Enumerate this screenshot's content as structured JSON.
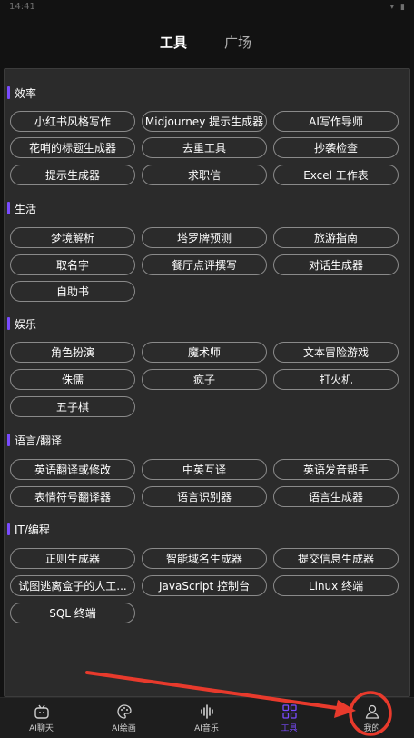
{
  "status_bar": {
    "time": "14:41",
    "icons": "▾ ▮"
  },
  "top_tabs": [
    {
      "label": "工具",
      "active": true
    },
    {
      "label": "广场",
      "active": false
    }
  ],
  "sections": [
    {
      "title": "效率",
      "items": [
        "小红书风格写作",
        "Midjourney 提示生成器",
        "AI写作导师",
        "花哨的标题生成器",
        "去重工具",
        "抄袭检查",
        "提示生成器",
        "求职信",
        "Excel 工作表"
      ]
    },
    {
      "title": "生活",
      "items": [
        "梦境解析",
        "塔罗牌预测",
        "旅游指南",
        "取名字",
        "餐厅点评撰写",
        "对话生成器",
        "自助书"
      ]
    },
    {
      "title": "娱乐",
      "items": [
        "角色扮演",
        "魔术师",
        "文本冒险游戏",
        "侏儒",
        "疯子",
        "打火机",
        "五子棋"
      ]
    },
    {
      "title": "语言/翻译",
      "items": [
        "英语翻译或修改",
        "中英互译",
        "英语发音帮手",
        "表情符号翻译器",
        "语言识别器",
        "语言生成器"
      ]
    },
    {
      "title": "IT/编程",
      "items": [
        "正则生成器",
        "智能域名生成器",
        "提交信息生成器",
        "试图逃离盒子的人工...",
        "JavaScript 控制台",
        "Linux 终端",
        "SQL 终端"
      ]
    }
  ],
  "bottom_nav": [
    {
      "label": "AI聊天",
      "icon": "tv-icon",
      "active": false
    },
    {
      "label": "AI绘画",
      "icon": "palette-icon",
      "active": false
    },
    {
      "label": "AI音乐",
      "icon": "sound-wave-icon",
      "active": false
    },
    {
      "label": "工具",
      "icon": "grid-icon",
      "active": true
    },
    {
      "label": "我的",
      "icon": "user-icon",
      "active": false
    }
  ],
  "colors": {
    "accent": "#7a4bff",
    "annotation_red": "#e83a2c",
    "background": "#121212",
    "panel": "#2b2b2b"
  }
}
